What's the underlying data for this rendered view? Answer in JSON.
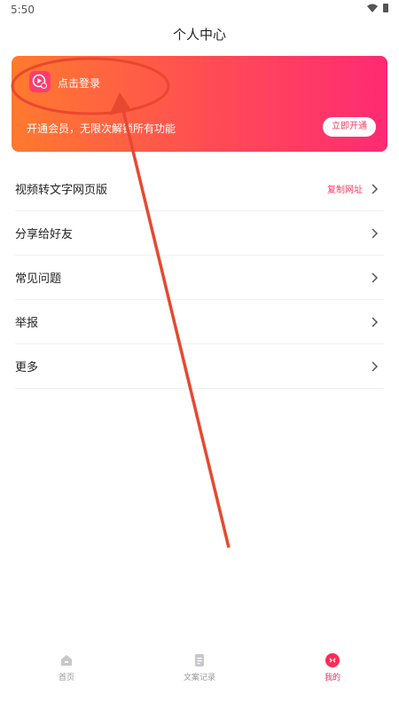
{
  "status_bar": {
    "time": "5:50"
  },
  "header": {
    "title": "个人中心"
  },
  "member_card": {
    "login_label": "点击登录",
    "vip_description": "开通会员，无限次解锁所有功能",
    "open_button_label": "立即开通"
  },
  "menu": {
    "items": [
      {
        "label": "视频转文字网页版",
        "extra": "复制网址"
      },
      {
        "label": "分享给好友"
      },
      {
        "label": "常见问题"
      },
      {
        "label": "举报"
      },
      {
        "label": "更多"
      }
    ]
  },
  "tabbar": {
    "items": [
      {
        "label": "首页",
        "icon": "home-icon"
      },
      {
        "label": "文案记录",
        "icon": "document-icon"
      },
      {
        "label": "我的",
        "icon": "profile-icon"
      }
    ],
    "active_color": "#ff2a55",
    "inactive_color": "#999999"
  },
  "colors": {
    "accent": "#ff3c5e",
    "gradient_start": "#ff7a2e",
    "gradient_end": "#ff2a74",
    "annotation": "#e8482f"
  }
}
